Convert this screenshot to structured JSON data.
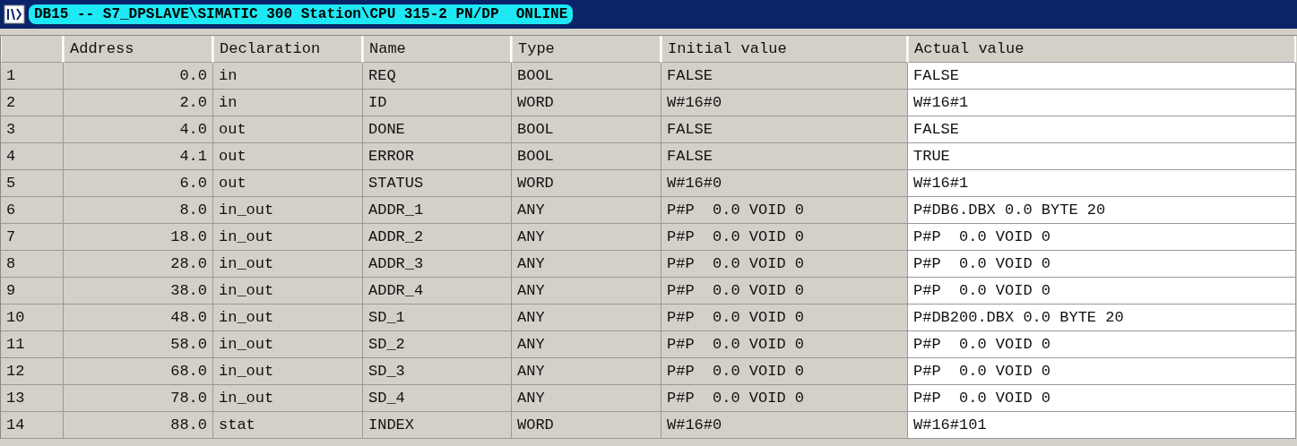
{
  "window": {
    "title": "DB15 -- S7_DPSLAVE\\SIMATIC 300 Station\\CPU 315-2 PN/DP  ONLINE"
  },
  "table": {
    "columns": [
      "Address",
      "Declaration",
      "Name",
      "Type",
      "Initial value",
      "Actual value"
    ],
    "rows": [
      {
        "row_number": "1",
        "address": "0.0",
        "declaration": "in",
        "name": "REQ",
        "type": "BOOL",
        "initial_value": "FALSE",
        "actual_value": "FALSE"
      },
      {
        "row_number": "2",
        "address": "2.0",
        "declaration": "in",
        "name": "ID",
        "type": "WORD",
        "initial_value": "W#16#0",
        "actual_value": "W#16#1"
      },
      {
        "row_number": "3",
        "address": "4.0",
        "declaration": "out",
        "name": "DONE",
        "type": "BOOL",
        "initial_value": "FALSE",
        "actual_value": "FALSE"
      },
      {
        "row_number": "4",
        "address": "4.1",
        "declaration": "out",
        "name": "ERROR",
        "type": "BOOL",
        "initial_value": "FALSE",
        "actual_value": "TRUE"
      },
      {
        "row_number": "5",
        "address": "6.0",
        "declaration": "out",
        "name": "STATUS",
        "type": "WORD",
        "initial_value": "W#16#0",
        "actual_value": "W#16#1"
      },
      {
        "row_number": "6",
        "address": "8.0",
        "declaration": "in_out",
        "name": "ADDR_1",
        "type": "ANY",
        "initial_value": "P#P  0.0 VOID 0",
        "actual_value": "P#DB6.DBX 0.0 BYTE 20"
      },
      {
        "row_number": "7",
        "address": "18.0",
        "declaration": "in_out",
        "name": "ADDR_2",
        "type": "ANY",
        "initial_value": "P#P  0.0 VOID 0",
        "actual_value": "P#P  0.0 VOID 0"
      },
      {
        "row_number": "8",
        "address": "28.0",
        "declaration": "in_out",
        "name": "ADDR_3",
        "type": "ANY",
        "initial_value": "P#P  0.0 VOID 0",
        "actual_value": "P#P  0.0 VOID 0"
      },
      {
        "row_number": "9",
        "address": "38.0",
        "declaration": "in_out",
        "name": "ADDR_4",
        "type": "ANY",
        "initial_value": "P#P  0.0 VOID 0",
        "actual_value": "P#P  0.0 VOID 0"
      },
      {
        "row_number": "10",
        "address": "48.0",
        "declaration": "in_out",
        "name": "SD_1",
        "type": "ANY",
        "initial_value": "P#P  0.0 VOID 0",
        "actual_value": "P#DB200.DBX 0.0 BYTE 20"
      },
      {
        "row_number": "11",
        "address": "58.0",
        "declaration": "in_out",
        "name": "SD_2",
        "type": "ANY",
        "initial_value": "P#P  0.0 VOID 0",
        "actual_value": "P#P  0.0 VOID 0"
      },
      {
        "row_number": "12",
        "address": "68.0",
        "declaration": "in_out",
        "name": "SD_3",
        "type": "ANY",
        "initial_value": "P#P  0.0 VOID 0",
        "actual_value": "P#P  0.0 VOID 0"
      },
      {
        "row_number": "13",
        "address": "78.0",
        "declaration": "in_out",
        "name": "SD_4",
        "type": "ANY",
        "initial_value": "P#P  0.0 VOID 0",
        "actual_value": "P#P  0.0 VOID 0"
      },
      {
        "row_number": "14",
        "address": "88.0",
        "declaration": "stat",
        "name": "INDEX",
        "type": "WORD",
        "initial_value": "W#16#0",
        "actual_value": "W#16#101"
      }
    ]
  }
}
